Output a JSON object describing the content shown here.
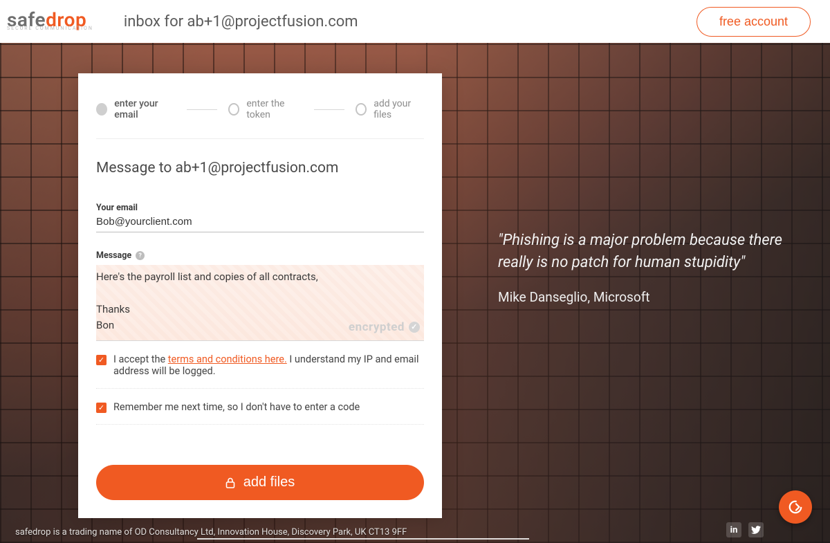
{
  "brand": {
    "part1": "safe",
    "part2": "drop",
    "tagline": "SECURE COMMUNICATION",
    "tm": "™"
  },
  "header": {
    "page_title": "inbox for ab+1@projectfusion.com",
    "free_account": "free account"
  },
  "quote": {
    "text": "\"Phishing is a major problem because there really is no patch for human stupidity\"",
    "author": "Mike Danseglio, Microsoft"
  },
  "steps": {
    "s1": "enter your email",
    "s2": "enter the token",
    "s3": "add your files"
  },
  "form": {
    "title": "Message to ab+1@projectfusion.com",
    "email_label": "Your email",
    "email_value": "Bob@yourclient.com",
    "message_label": "Message",
    "message_line1": "Here's the payroll list and copies of all contracts,",
    "message_line2": "Thanks",
    "message_line3": "Bon",
    "encrypted_badge": "encrypted",
    "terms_prefix": "I accept the ",
    "terms_link": "terms and conditions here.",
    "terms_suffix": " I understand my IP and email address will be logged.",
    "remember_label": "Remember me next time, so I don't have to enter a code",
    "cta": "add files"
  },
  "footer": {
    "text": "safedrop is a trading name of OD Consultancy Ltd, Innovation House, Discovery Park, UK CT13 9FF"
  },
  "colors": {
    "accent": "#f05a22"
  }
}
